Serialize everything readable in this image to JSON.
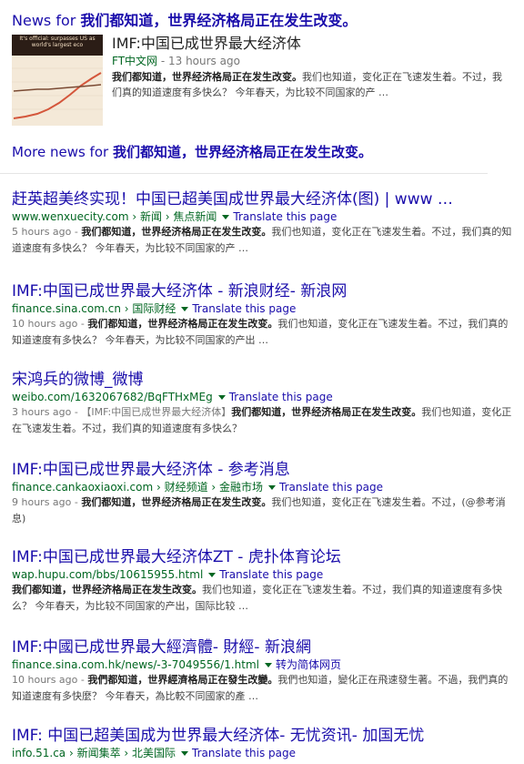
{
  "news": {
    "heading_prefix": "News for ",
    "heading_query": "我们都知道，世界经济格局正在发生改变。",
    "thumb_caption": "It's official: surpasses US as world's largest eco",
    "title": "IMF:中国已成世界最大经济体",
    "source": "FT中文网",
    "age": " - 13 hours ago",
    "snippet_bold": "我们都知道，世界经济格局正在发生改变。",
    "snippet_rest": "我们也知道，变化正在飞速发生着。不过，我们真的知道速度有多快么？ 今年春天，为比较不同国家的产 …",
    "more_prefix": "More news for ",
    "more_query": "我们都知道，世界经济格局正在发生改变。"
  },
  "results": [
    {
      "title": "赶英超美终实现！中国已超美国成世界最大经济体(图) | www …",
      "url": "www.wenxuecity.com › 新闻 › 焦点新闻",
      "translate": "Translate this page",
      "age": "5 hours ago - ",
      "bold": "我们都知道，世界经济格局正在发生改变。",
      "rest": "我们也知道，变化正在飞速发生着。不过，我们真的知道速度有多快么？ 今年春天，为比较不同国家的产 …"
    },
    {
      "title": "IMF:中国已成世界最大经济体 - 新浪财经- 新浪网",
      "url": "finance.sina.com.cn › 国际财经",
      "translate": "Translate this page",
      "age": "10 hours ago - ",
      "bold": "我们都知道，世界经济格局正在发生改变。",
      "rest": "我们也知道，变化正在飞速发生着。不过，我们真的知道速度有多快么？ 今年春天，为比较不同国家的产出 …"
    },
    {
      "title": "宋鸿兵的微博_微博",
      "url": "weibo.com/1632067682/BqFTHxMEg",
      "translate": "Translate this page",
      "age": "3 hours ago - 【IMF:中国已成世界最大经济体】",
      "bold": "我们都知道，世界经济格局正在发生改变。",
      "rest": "我们也知道，变化正在飞速发生着。不过，我们真的知道速度有多快么？"
    },
    {
      "title": "IMF:中国已成世界最大经济体 - 参考消息",
      "url": "finance.cankaoxiaoxi.com › 财经频道 › 金融市场",
      "translate": "Translate this page",
      "age": "9 hours ago - ",
      "bold": "我们都知道，世界经济格局正在发生改变。",
      "rest": "我们也知道，变化正在飞速发生着。不过，(@参考消息)"
    },
    {
      "title": "IMF:中国已成世界最大经济体ZT - 虎扑体育论坛",
      "url": "wap.hupu.com/bbs/10615955.html",
      "translate": "Translate this page",
      "age": "",
      "bold": "我们都知道，世界经济格局正在发生改变。",
      "rest": "我们也知道，变化正在飞速发生着。不过，我们真的知道速度有多快么？ 今年春天，为比较不同国家的产出，国际比较 …"
    },
    {
      "title": "IMF:中國已成世界最大經濟體- 財經- 新浪網",
      "url": "finance.sina.com.hk/news/-3-7049556/1.html",
      "translate": "转为简体网页",
      "age": "10 hours ago - ",
      "bold": "我們都知道，世界經濟格局正在發生改變。",
      "rest": "我們也知道，變化正在飛速發生著。不過，我們真的知道速度有多快麼？ 今年春天，為比較不同國家的產 …"
    },
    {
      "title": "IMF: 中国已超美国成为世界最大经济体- 无忧资讯- 加国无忧",
      "url": "info.51.ca › 新闻集萃 › 北美国际",
      "translate": "Translate this page",
      "age": "",
      "bold": "",
      "rest": ""
    }
  ]
}
